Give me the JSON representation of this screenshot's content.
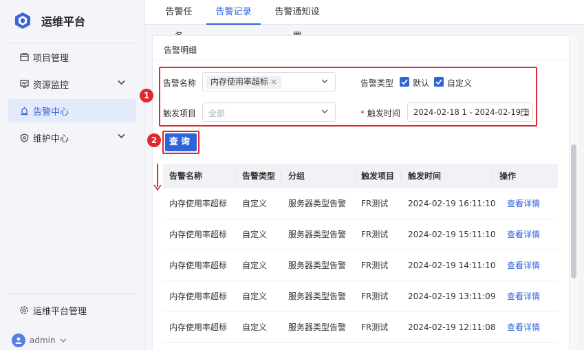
{
  "app": {
    "title": "运维平台"
  },
  "sidebar": {
    "items": [
      {
        "label": "项目管理",
        "icon": "folder-icon"
      },
      {
        "label": "资源监控",
        "icon": "monitor-icon"
      },
      {
        "label": "告警中心",
        "icon": "alarm-icon"
      },
      {
        "label": "维护中心",
        "icon": "shield-icon"
      }
    ],
    "settings_label": "运维平台管理",
    "user": "admin"
  },
  "tabs": [
    {
      "label": "告警任务"
    },
    {
      "label": "告警记录"
    },
    {
      "label": "告警通知设置"
    }
  ],
  "card": {
    "title": "告警明细"
  },
  "filters": {
    "alarm_name_label": "告警名称",
    "alarm_name_chip": "内存使用率超标",
    "alarm_type_label": "告警类型",
    "type_default": "默认",
    "type_custom": "自定义",
    "trigger_item_label": "触发项目",
    "trigger_item_placeholder": "全部",
    "trigger_time_label": "触发时间",
    "trigger_time_value": "2024-02-18 1 - 2024-02-19 1",
    "required_mark": "*"
  },
  "annotations": {
    "badge1": "1",
    "badge2": "2"
  },
  "query_button": "查询",
  "table": {
    "headers": [
      "告警名称",
      "告警类型",
      "分组",
      "触发项目",
      "触发时间",
      "操作"
    ],
    "rows": [
      [
        "内存使用率超标",
        "自定义",
        "服务器类型告警",
        "FR测试",
        "2024-02-19 16:11:10",
        "查看详情"
      ],
      [
        "内存使用率超标",
        "自定义",
        "服务器类型告警",
        "FR测试",
        "2024-02-19 15:11:10",
        "查看详情"
      ],
      [
        "内存使用率超标",
        "自定义",
        "服务器类型告警",
        "FR测试",
        "2024-02-19 14:11:10",
        "查看详情"
      ],
      [
        "内存使用率超标",
        "自定义",
        "服务器类型告警",
        "FR测试",
        "2024-02-19 13:11:09",
        "查看详情"
      ],
      [
        "内存使用率超标",
        "自定义",
        "服务器类型告警",
        "FR测试",
        "2024-02-19 12:11:08",
        "查看详情"
      ]
    ]
  },
  "colors": {
    "primary": "#2f63d9",
    "annotation": "#e0282e",
    "active_bg": "#e3eafa"
  }
}
